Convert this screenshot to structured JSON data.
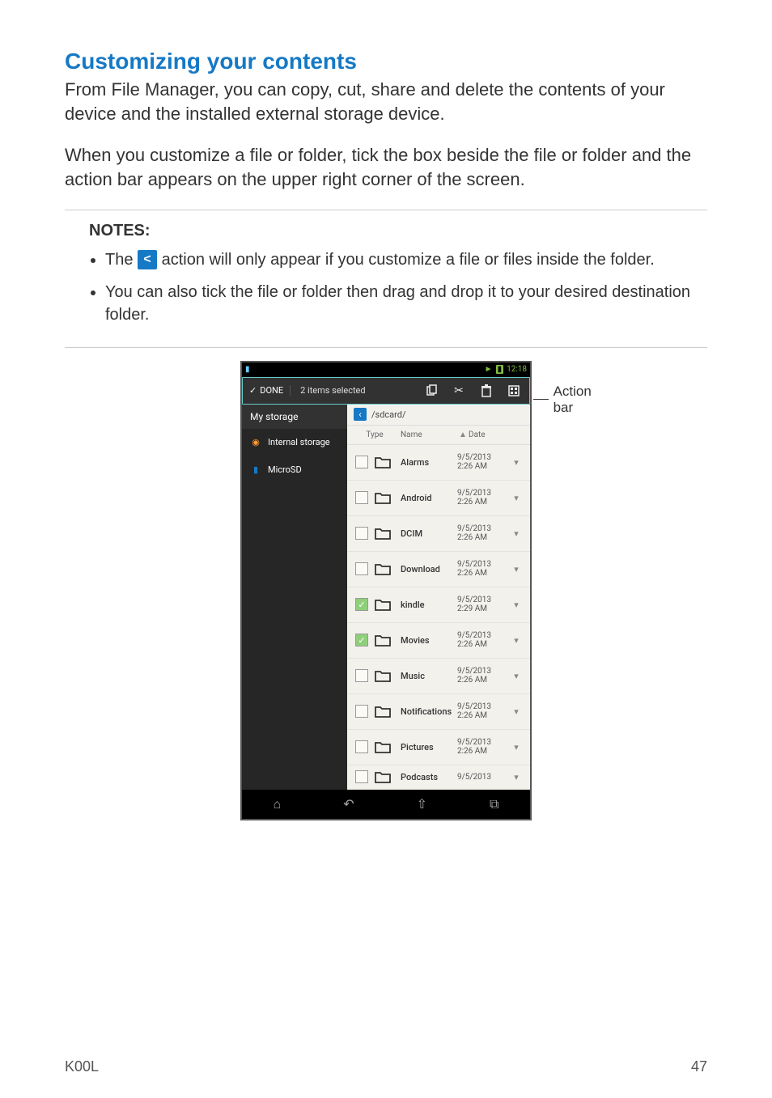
{
  "heading": "Customizing your contents",
  "para1": "From File Manager, you can copy, cut, share and delete the contents of your device and the installed external storage device.",
  "para2": "When you customize a file or folder, tick the box beside the file or folder and the action bar appears on the upper right corner of the screen.",
  "notes": {
    "title": "NOTES:",
    "item1_a": "The ",
    "item1_b": " action will only appear if you customize a file or files inside the folder.",
    "share_glyph": "<",
    "item2": "You can also tick the file or folder then drag and drop it to your desired destination folder."
  },
  "callout": "Action bar",
  "device": {
    "status_time": "12:18",
    "actionbar": {
      "done": "DONE",
      "selected": "2 items selected"
    },
    "sidebar": {
      "title": "My storage",
      "internal": "Internal storage",
      "microsd": "MicroSD"
    },
    "path": "/sdcard/",
    "cols": {
      "type": "Type",
      "name": "Name",
      "date": "Date"
    },
    "rows": [
      {
        "name": "Alarms",
        "date": "9/5/2013",
        "time": "2:26 AM",
        "checked": false
      },
      {
        "name": "Android",
        "date": "9/5/2013",
        "time": "2:26 AM",
        "checked": false
      },
      {
        "name": "DCIM",
        "date": "9/5/2013",
        "time": "2:26 AM",
        "checked": false
      },
      {
        "name": "Download",
        "date": "9/5/2013",
        "time": "2:26 AM",
        "checked": false
      },
      {
        "name": "kindle",
        "date": "9/5/2013",
        "time": "2:29 AM",
        "checked": true
      },
      {
        "name": "Movies",
        "date": "9/5/2013",
        "time": "2:26 AM",
        "checked": true
      },
      {
        "name": "Music",
        "date": "9/5/2013",
        "time": "2:26 AM",
        "checked": false
      },
      {
        "name": "Notifications",
        "date": "9/5/2013",
        "time": "2:26 AM",
        "checked": false
      },
      {
        "name": "Pictures",
        "date": "9/5/2013",
        "time": "2:26 AM",
        "checked": false
      },
      {
        "name": "Podcasts",
        "date": "9/5/2013",
        "time": "",
        "checked": false
      }
    ]
  },
  "footer": {
    "model": "K00L",
    "page": "47"
  }
}
